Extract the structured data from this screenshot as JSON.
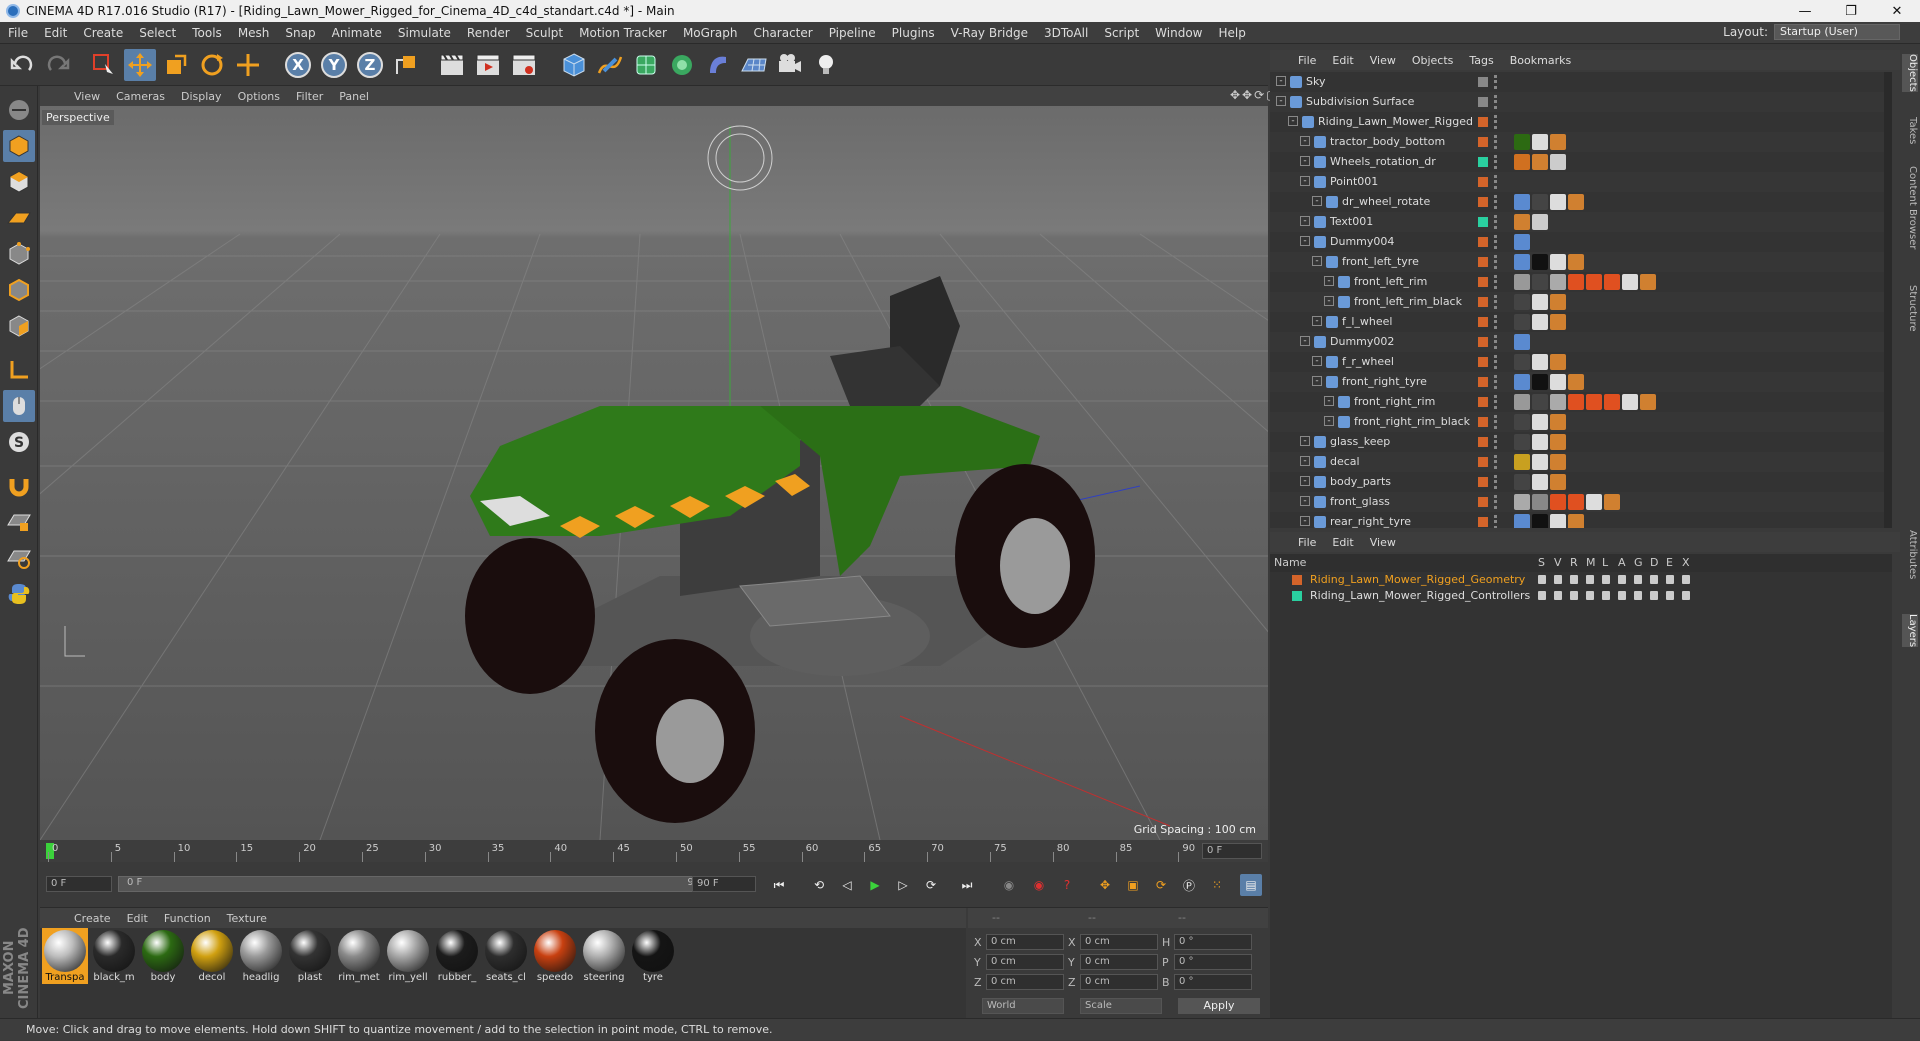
{
  "window": {
    "title": "CINEMA 4D R17.016 Studio (R17) - [Riding_Lawn_Mower_Rigged_for_Cinema_4D_c4d_standart.c4d *] - Main",
    "controls": [
      "—",
      "❐",
      "✕"
    ]
  },
  "menubar": {
    "items": [
      "File",
      "Edit",
      "Create",
      "Select",
      "Tools",
      "Mesh",
      "Snap",
      "Animate",
      "Simulate",
      "Render",
      "Sculpt",
      "Motion Tracker",
      "MoGraph",
      "Character",
      "Pipeline",
      "Plugins",
      "V-Ray Bridge",
      "3DToAll",
      "Script",
      "Window",
      "Help"
    ],
    "layout_label": "Layout:",
    "layout_value": "Startup (User)"
  },
  "viewport": {
    "menu": [
      "View",
      "Cameras",
      "Display",
      "Options",
      "Filter",
      "Panel"
    ],
    "label": "Perspective",
    "grid_spacing": "Grid Spacing : 100 cm"
  },
  "timeline": {
    "ticks": [
      "0",
      "5",
      "10",
      "15",
      "20",
      "25",
      "30",
      "35",
      "40",
      "45",
      "50",
      "55",
      "60",
      "65",
      "70",
      "75",
      "80",
      "85",
      "90"
    ],
    "current_frame": "0 F",
    "start_field": "0 F",
    "range_start": "0 F",
    "range_end": "90 F",
    "end_field": "90 F"
  },
  "material_manager": {
    "menu": [
      "Create",
      "Edit",
      "Function",
      "Texture"
    ],
    "materials": [
      {
        "name": "Transpa",
        "color": "#bdbdbd",
        "selected": true
      },
      {
        "name": "black_m",
        "color": "#2a2a2a"
      },
      {
        "name": "body",
        "color": "#2c6a12"
      },
      {
        "name": "decol",
        "color": "#d0a010"
      },
      {
        "name": "headlig",
        "color": "#9a9a9a"
      },
      {
        "name": "plast",
        "color": "#333"
      },
      {
        "name": "rim_met",
        "color": "#8a8a8a"
      },
      {
        "name": "rim_yell",
        "color": "#a8a8a8"
      },
      {
        "name": "rubber_",
        "color": "#1c1c1c"
      },
      {
        "name": "seats_cl",
        "color": "#2e2e2e"
      },
      {
        "name": "speedo",
        "color": "#c84010"
      },
      {
        "name": "steering",
        "color": "#b0b0b0"
      },
      {
        "name": "tyre",
        "color": "#141414"
      }
    ]
  },
  "coordinates": {
    "headers": [
      "--",
      "--",
      "--"
    ],
    "rows": [
      {
        "a": "X",
        "av": "0 cm",
        "b": "X",
        "bv": "0 cm",
        "c": "H",
        "cv": "0 °"
      },
      {
        "a": "Y",
        "av": "0 cm",
        "b": "Y",
        "bv": "0 cm",
        "c": "P",
        "cv": "0 °"
      },
      {
        "a": "Z",
        "av": "0 cm",
        "b": "Z",
        "bv": "0 cm",
        "c": "B",
        "cv": "0 °"
      }
    ],
    "world": "World",
    "scale": "Scale",
    "apply": "Apply"
  },
  "object_manager": {
    "menu": [
      "File",
      "Edit",
      "View",
      "Objects",
      "Tags",
      "Bookmarks"
    ],
    "objects": [
      {
        "name": "Sky",
        "indent": 0,
        "dot": "#888",
        "tags": []
      },
      {
        "name": "Subdivision Surface",
        "indent": 0,
        "dot": "#888",
        "tags": []
      },
      {
        "name": "Riding_Lawn_Mower_Rigged",
        "indent": 1,
        "dot": "#d4642a",
        "tags": []
      },
      {
        "name": "tractor_body_bottom",
        "indent": 2,
        "dot": "#d4642a",
        "tags": [
          "#2c6a12",
          "#ddd",
          "#d08030"
        ]
      },
      {
        "name": "Wheels_rotation_dr",
        "indent": 2,
        "dot": "#2ad0a0",
        "tags": [
          "#d07020",
          "#d08030",
          "#ccc"
        ]
      },
      {
        "name": "Point001",
        "indent": 2,
        "dot": "#d4642a",
        "tags": []
      },
      {
        "name": "dr_wheel_rotate",
        "indent": 3,
        "dot": "#d4642a",
        "tags": [
          "#5a8ad0",
          "#444",
          "#ddd",
          "#d08030"
        ]
      },
      {
        "name": "Text001",
        "indent": 2,
        "dot": "#2ad0a0",
        "tags": [
          "#d08030",
          "#ccc"
        ]
      },
      {
        "name": "Dummy004",
        "indent": 2,
        "dot": "#d4642a",
        "tags": [
          "#5a8ad0"
        ]
      },
      {
        "name": "front_left_tyre",
        "indent": 3,
        "dot": "#d4642a",
        "tags": [
          "#5a8ad0",
          "#111",
          "#ddd",
          "#d08030"
        ]
      },
      {
        "name": "front_left_rim",
        "indent": 4,
        "dot": "#d4642a",
        "tags": [
          "#999",
          "#444",
          "#aaa",
          "#e05020",
          "#e05020",
          "#e05020",
          "#ddd",
          "#d08030"
        ]
      },
      {
        "name": "front_left_rim_black",
        "indent": 4,
        "dot": "#d4642a",
        "tags": [
          "#444",
          "#ddd",
          "#d08030"
        ]
      },
      {
        "name": "f_l_wheel",
        "indent": 3,
        "dot": "#d4642a",
        "tags": [
          "#444",
          "#ddd",
          "#d08030"
        ]
      },
      {
        "name": "Dummy002",
        "indent": 2,
        "dot": "#d4642a",
        "tags": [
          "#5a8ad0"
        ]
      },
      {
        "name": "f_r_wheel",
        "indent": 3,
        "dot": "#d4642a",
        "tags": [
          "#444",
          "#ddd",
          "#d08030"
        ]
      },
      {
        "name": "front_right_tyre",
        "indent": 3,
        "dot": "#d4642a",
        "tags": [
          "#5a8ad0",
          "#111",
          "#ddd",
          "#d08030"
        ]
      },
      {
        "name": "front_right_rim",
        "indent": 4,
        "dot": "#d4642a",
        "tags": [
          "#999",
          "#444",
          "#aaa",
          "#e05020",
          "#e05020",
          "#e05020",
          "#ddd",
          "#d08030"
        ]
      },
      {
        "name": "front_right_rim_black",
        "indent": 4,
        "dot": "#d4642a",
        "tags": [
          "#444",
          "#ddd",
          "#d08030"
        ]
      },
      {
        "name": "glass_keep",
        "indent": 2,
        "dot": "#d4642a",
        "tags": [
          "#444",
          "#ddd",
          "#d08030"
        ]
      },
      {
        "name": "decal",
        "indent": 2,
        "dot": "#d4642a",
        "tags": [
          "#c8a020",
          "#ddd",
          "#d08030"
        ]
      },
      {
        "name": "body_parts",
        "indent": 2,
        "dot": "#d4642a",
        "tags": [
          "#444",
          "#ddd",
          "#d08030"
        ]
      },
      {
        "name": "front_glass",
        "indent": 2,
        "dot": "#d4642a",
        "tags": [
          "#aaa",
          "#888",
          "#e05020",
          "#e05020",
          "#ddd",
          "#d08030"
        ]
      },
      {
        "name": "rear_right_tyre",
        "indent": 2,
        "dot": "#d4642a",
        "tags": [
          "#5a8ad0",
          "#111",
          "#ddd",
          "#d08030"
        ]
      }
    ]
  },
  "layer_manager": {
    "menu": [
      "File",
      "Edit",
      "View"
    ],
    "header": {
      "name": "Name",
      "cols": [
        "S",
        "V",
        "R",
        "M",
        "L",
        "A",
        "G",
        "D",
        "E",
        "X"
      ]
    },
    "layers": [
      {
        "name": "Riding_Lawn_Mower_Rigged_Geometry",
        "color": "#d4642a",
        "active": true
      },
      {
        "name": "Riding_Lawn_Mower_Rigged_Controllers",
        "color": "#2ad0a0",
        "active": false
      }
    ]
  },
  "right_tabs": [
    "Objects",
    "Takes",
    "Content Browser",
    "Structure",
    "Attributes",
    "Layers"
  ],
  "status": "Move: Click and drag to move elements. Hold down SHIFT to quantize movement / add to the selection in point mode, CTRL to remove.",
  "brand": "MAXON CINEMA 4D"
}
